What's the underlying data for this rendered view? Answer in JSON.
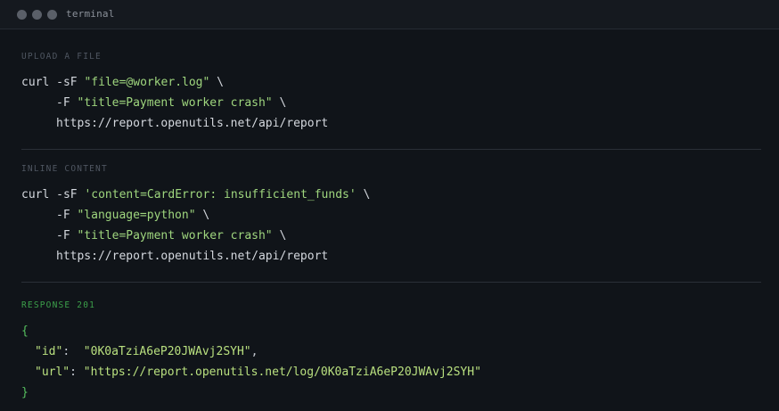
{
  "window": {
    "title": "terminal"
  },
  "upload": {
    "label": "UPLOAD A FILE",
    "line1_cmd": "curl -sF ",
    "line1_str": "\"file=@worker.log\"",
    "line1_tail": " \\",
    "line2_cmd": "-F ",
    "line2_str": "\"title=Payment worker crash\"",
    "line2_tail": " \\",
    "line3_url": "https://report.openutils.net/api/report"
  },
  "inline": {
    "label": "INLINE CONTENT",
    "line1_cmd": "curl -sF ",
    "line1_str": "'content=CardError: insufficient_funds'",
    "line1_tail": " \\",
    "line2_cmd": "-F ",
    "line2_str": "\"language=python\"",
    "line2_tail": " \\",
    "line3_cmd": "-F ",
    "line3_str": "\"title=Payment worker crash\"",
    "line3_tail": " \\",
    "line4_url": "https://report.openutils.net/api/report"
  },
  "response": {
    "label": "RESPONSE 201",
    "open_brace": "{",
    "close_brace": "}",
    "id_key": "\"id\"",
    "id_sep": ":  ",
    "id_value": "\"0K0aTziA6eP20JWAvj2SYH\"",
    "id_tail": ",",
    "url_key": "\"url\"",
    "url_sep": ": ",
    "url_value": "\"https://report.openutils.net/log/0K0aTziA6eP20JWAvj2SYH\""
  }
}
